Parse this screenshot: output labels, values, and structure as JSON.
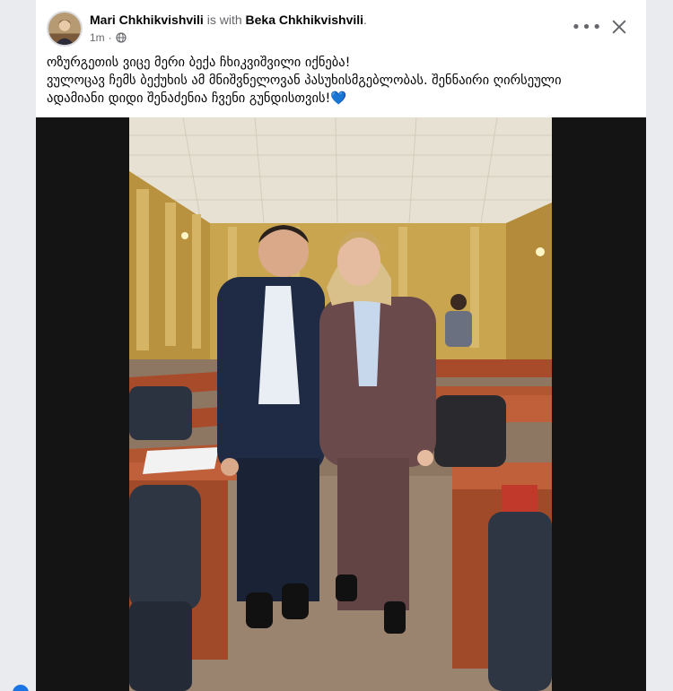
{
  "post": {
    "author": "Mari Chkhikvishvili",
    "with_text": "is with",
    "tagged": "Beka Chkhikvishvili",
    "tagged_suffix": ".",
    "time": "1m",
    "dot": "·",
    "audience_icon": "globe-icon",
    "text_lines": [
      "ოზურგეთის ვიცე მერი ბექა ჩხიკვიშვილი იქნება!",
      "ვულოცავ ჩემს ბექუხის ამ მნიშვნელოვან პასუხისმგებლობას. შენნაირი ღირსეული",
      "ადამიანი დიდი შენაძენია ჩვენი გუნდისთვის!💙"
    ]
  },
  "controls": {
    "more_label": "•••",
    "more_icon": "more-options-icon",
    "close_icon": "close-icon"
  },
  "colors": {
    "card_bg": "#ffffff",
    "page_bg": "#e9ebee",
    "muted_text": "#65676b",
    "accent": "#1b74e4"
  }
}
